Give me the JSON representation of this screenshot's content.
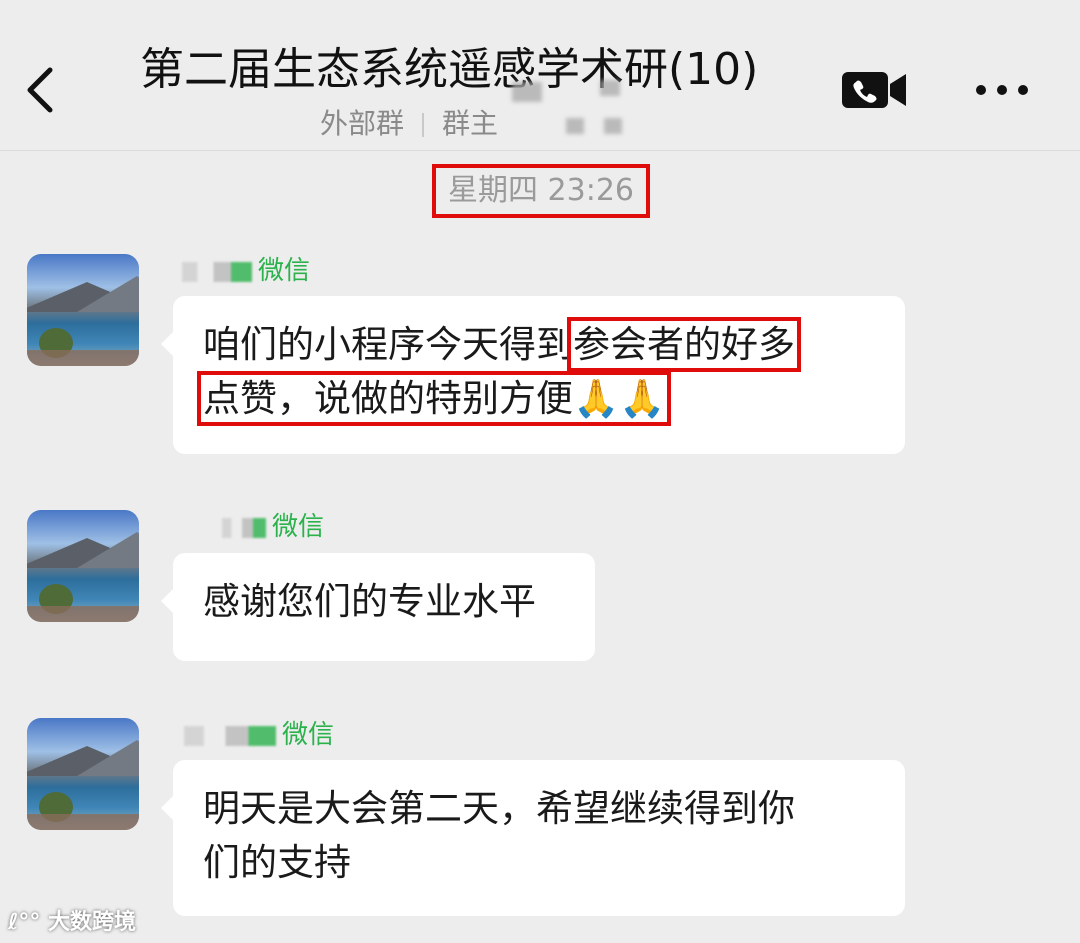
{
  "header": {
    "title": "第二届生态系统遥感学术研",
    "count": "(10)",
    "subtitle_external": "外部群",
    "subtitle_role": "群主"
  },
  "timestamp": "星期四 23:26",
  "messages": [
    {
      "sender_suffix": "微信",
      "line1_a": "咱们的小程序今天得到",
      "line1_b": "参会者的好多",
      "line2": "点赞，说做的特别方便",
      "emoji": "🙏🙏"
    },
    {
      "sender_suffix": "微信",
      "text": "感谢您们的专业水平"
    },
    {
      "sender_suffix": "微信",
      "line1": "明天是大会第二天，希望继续得到你",
      "line2": "们的支持"
    }
  ],
  "watermark": "大数跨境",
  "icons": [
    "back-icon",
    "video-call-icon",
    "more-icon"
  ],
  "colors": {
    "highlight": "#e00b0b",
    "wechat_green": "#2bb24c",
    "background": "#ededed"
  }
}
